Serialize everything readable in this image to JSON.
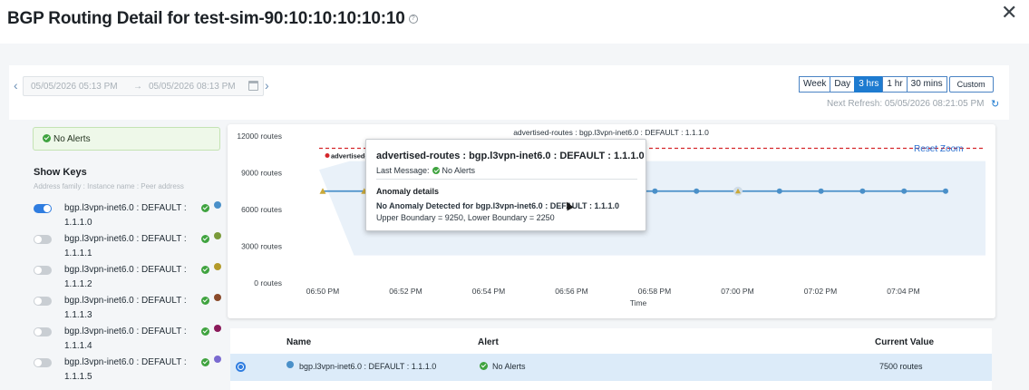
{
  "modal": {
    "title": "BGP Routing Detail for test-sim-90:10:10:10:10:10",
    "help_icon": "question-circle-icon",
    "close_icon": "close-icon",
    "close_glyph": "✕"
  },
  "toolbar": {
    "prev_glyph": "‹",
    "next_glyph": "›",
    "date_from": "05/05/2026 05:13 PM",
    "arrow": "→",
    "date_to": "05/05/2026 08:13 PM",
    "ranges": [
      "Week",
      "Day",
      "3 hrs",
      "1 hr",
      "30 mins"
    ],
    "active_range": "3 hrs",
    "custom_label": "Custom",
    "next_refresh": "Next Refresh: 05/05/2026 08:21:05 PM",
    "refresh_glyph": "↻"
  },
  "alert_box": {
    "text": "No Alerts"
  },
  "keys": {
    "title": "Show Keys",
    "subtitle": "Address family : Instance name : Peer address",
    "items": [
      {
        "label": "bgp.l3vpn-inet6.0 : DEFAULT : 1.1.1.0",
        "enabled": true,
        "color": "#4a90c9"
      },
      {
        "label": "bgp.l3vpn-inet6.0 : DEFAULT : 1.1.1.1",
        "enabled": false,
        "color": "#7a9a3a"
      },
      {
        "label": "bgp.l3vpn-inet6.0 : DEFAULT : 1.1.1.2",
        "enabled": false,
        "color": "#b39a2a"
      },
      {
        "label": "bgp.l3vpn-inet6.0 : DEFAULT : 1.1.1.3",
        "enabled": false,
        "color": "#8a4a2a"
      },
      {
        "label": "bgp.l3vpn-inet6.0 : DEFAULT : 1.1.1.4",
        "enabled": false,
        "color": "#8a1a5a"
      },
      {
        "label": "bgp.l3vpn-inet6.0 : DEFAULT : 1.1.1.5",
        "enabled": false,
        "color": "#7a6ad0"
      }
    ]
  },
  "chart_data": {
    "type": "line",
    "title": "advertised-routes : bgp.l3vpn-inet6.0 : DEFAULT : 1.1.1.0",
    "xlabel": "Time",
    "ylabel": "",
    "x_ticks": [
      "06:50 PM",
      "06:52 PM",
      "06:54 PM",
      "06:56 PM",
      "06:58 PM",
      "07:00 PM",
      "07:02 PM",
      "07:04 PM"
    ],
    "y_ticks": [
      "12000 routes",
      "9000 routes",
      "6000 routes",
      "3000 routes",
      "0 routes"
    ],
    "ylim": [
      0,
      12000
    ],
    "series": [
      {
        "values": [
          7500,
          7500,
          7500,
          7500,
          7500,
          7500,
          7500,
          7500,
          7500,
          7500,
          7500,
          7500,
          7500,
          7500,
          7500,
          7500
        ],
        "color": "#4a90c9"
      }
    ],
    "x_minutes": [
      0,
      1,
      2,
      3,
      4,
      5,
      6,
      7,
      8,
      9,
      10,
      11,
      12,
      13,
      14,
      15
    ],
    "upper_boundary": 9250,
    "lower_boundary": 2250,
    "threshold_label": "advertised-",
    "reset_zoom": "Reset Zoom",
    "colors": {
      "threshold": "#d4262b",
      "band": "#e4edf7",
      "anomaly_marker": "#c9a93a"
    }
  },
  "tooltip": {
    "title": "advertised-routes : bgp.l3vpn-inet6.0 : DEFAULT : 1.1.1.0",
    "last_message_label": "Last Message:",
    "last_message": "No Alerts",
    "anomaly_title": "Anomaly details",
    "detail": "No Anomaly Detected for bgp.l3vpn-inet6.0 : DEFAULT : 1.1.1.0",
    "boundaries": "Upper Boundary = 9250, Lower Boundary = 2250"
  },
  "table": {
    "columns": [
      "Name",
      "Alert",
      "Current Value"
    ],
    "rows": [
      {
        "name": "bgp.l3vpn-inet6.0 : DEFAULT : 1.1.1.0",
        "alert": "No Alerts",
        "value": "7500 routes"
      }
    ]
  }
}
